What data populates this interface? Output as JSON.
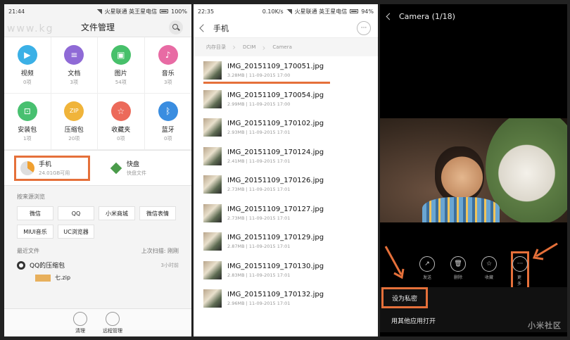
{
  "panel1": {
    "status": {
      "time": "21:44",
      "carriers": "火星联通 英王星电信",
      "battery": "100%"
    },
    "watermark": "www.kg",
    "title": "文件管理",
    "categories": [
      {
        "label": "视频",
        "count": "0项",
        "color": "#3bb0e6",
        "glyph": "▶"
      },
      {
        "label": "文档",
        "count": "3项",
        "color": "#8f6ad6",
        "glyph": "≡"
      },
      {
        "label": "图片",
        "count": "54项",
        "color": "#47c06a",
        "glyph": "▣"
      },
      {
        "label": "音乐",
        "count": "3项",
        "color": "#e86ba4",
        "glyph": "♪"
      },
      {
        "label": "安装包",
        "count": "1项",
        "color": "#48c070",
        "glyph": "⊡"
      },
      {
        "label": "压缩包",
        "count": "20项",
        "color": "#f0b43a",
        "glyph": "ZIP"
      },
      {
        "label": "收藏夹",
        "count": "0项",
        "color": "#ec6a5a",
        "glyph": "☆"
      },
      {
        "label": "蓝牙",
        "count": "0项",
        "color": "#3a8de0",
        "glyph": "ᛒ"
      }
    ],
    "storage": {
      "phone_name": "手机",
      "phone_usage": "24.01GB可用",
      "quick_name": "快盘",
      "quick_sub": "快盘文件"
    },
    "browse_label": "按来源浏览",
    "sources": [
      "微信",
      "QQ",
      "小米商城",
      "微信表情",
      "MIUI音乐",
      "UC浏览器"
    ],
    "recent_label": "最近文件",
    "last_scan": "上次扫描: 刚刚",
    "recent_item": {
      "name": "QQ的压缩包",
      "time": "3小时前"
    },
    "recent_file": "七.zip",
    "bottom_buttons": [
      "清理",
      "远程管理"
    ]
  },
  "panel2": {
    "status": {
      "time": "22:35",
      "speed": "0.10K/s",
      "carriers": "火星联通 英王星电信",
      "battery": "94%"
    },
    "title": "手机",
    "crumbs": [
      "内存目录",
      "DCIM",
      "Camera"
    ],
    "more": "···",
    "files": [
      {
        "name": "IMG_20151109_170051.jpg",
        "meta": "3.28MB | 11-09-2015 17:00"
      },
      {
        "name": "IMG_20151109_170054.jpg",
        "meta": "2.99MB | 11-09-2015 17:00"
      },
      {
        "name": "IMG_20151109_170102.jpg",
        "meta": "2.93MB | 11-09-2015 17:01"
      },
      {
        "name": "IMG_20151109_170124.jpg",
        "meta": "2.41MB | 11-09-2015 17:01"
      },
      {
        "name": "IMG_20151109_170126.jpg",
        "meta": "2.73MB | 11-09-2015 17:01"
      },
      {
        "name": "IMG_20151109_170127.jpg",
        "meta": "2.73MB | 11-09-2015 17:01"
      },
      {
        "name": "IMG_20151109_170129.jpg",
        "meta": "2.87MB | 11-09-2015 17:01"
      },
      {
        "name": "IMG_20151109_170130.jpg",
        "meta": "2.83MB | 11-09-2015 17:01"
      },
      {
        "name": "IMG_20151109_170132.jpg",
        "meta": "2.96MB | 11-09-2015 17:01"
      }
    ]
  },
  "panel3": {
    "title": "Camera (1/18)",
    "actions": [
      {
        "label": "发送",
        "glyph": "↗"
      },
      {
        "label": "删除",
        "glyph": "🗑"
      },
      {
        "label": "收藏",
        "glyph": "☆"
      },
      {
        "label": "更多",
        "glyph": "···"
      }
    ],
    "menu": [
      "设为私密",
      "用其他应用打开"
    ],
    "site_mark": "小米社区"
  },
  "colors": {
    "highlight": "#e5703a"
  }
}
